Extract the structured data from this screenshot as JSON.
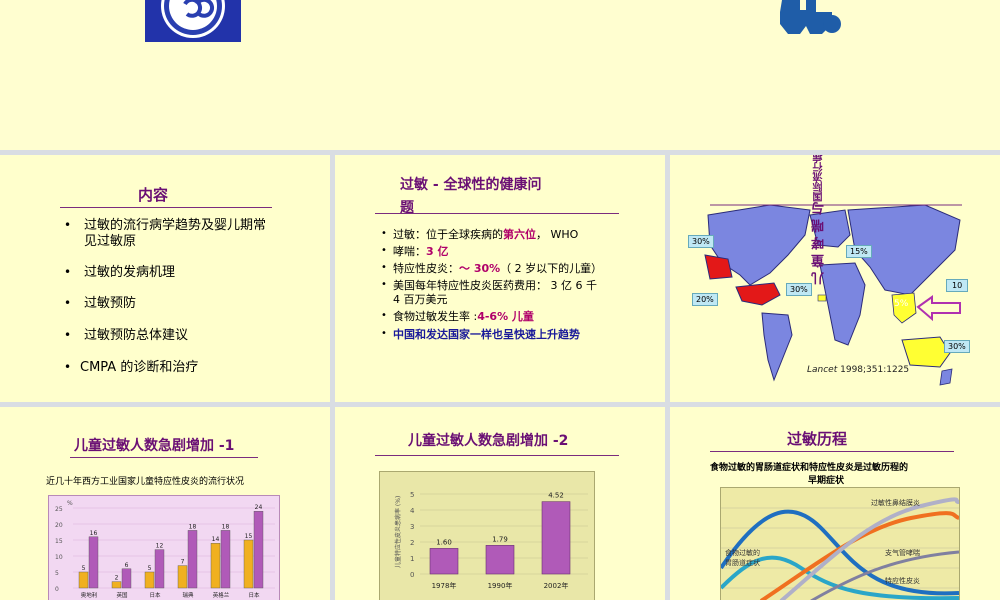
{
  "slide1": {
    "title": "内容",
    "items": [
      "过敏的流行病学趋势及婴儿期常见过敏原",
      "过敏的发病机理",
      "过敏预防",
      "过敏预防总体建议",
      "CMPA 的诊断和治疗"
    ]
  },
  "slide2": {
    "title_a": "过敏 - 全球性的健康问",
    "title_b": "题",
    "b1_pre": "过敏：位于全球疾病的",
    "b1_em": "第六位",
    "b1_post": "， WHO",
    "b2_pre": "哮喘：",
    "b2_em": "3 亿",
    "b3_pre": "特应性皮炎：",
    "b3_em": "～ 30%",
    "b3_post": "（ 2 岁以下的儿童）",
    "b4_a": "美国每年特应性皮炎医药费用： 3 亿 6 千",
    "b4_b": "4 百万美元",
    "b5_pre": "食物过敏发生率 :",
    "b5_em": "4-6% 儿童",
    "b6": "中国和发达国家一样也呈快速上升趋势"
  },
  "slide3": {
    "vtitle_a": "儿 童 哮 喘 与",
    "vtitle_b": "国际流行病学",
    "labels": [
      "30%",
      "15%",
      "20%",
      "30%",
      "10",
      "5%",
      "30%"
    ],
    "citation_a": "Lancet",
    "citation_b": " 1998;351:1225"
  },
  "slide4": {
    "title": "儿童过敏人数急剧增加 -1",
    "subtitle": "近几十年西方工业国家儿童特应性皮炎的流行状况",
    "y_unit": "%",
    "y_ticks": [
      "25",
      "20",
      "15",
      "10",
      "5",
      "0"
    ],
    "countries": [
      "奥地利",
      "英国",
      "日本",
      "瑞典",
      "英格兰",
      "日本"
    ]
  },
  "slide5": {
    "title": "儿童过敏人数急剧增加 -2",
    "y_label": "儿童特应性皮炎患病率 (%)",
    "y_ticks": [
      "5",
      "4",
      "3",
      "2",
      "1",
      "0"
    ]
  },
  "slide6": {
    "title": "过敏历程",
    "subtitle_a": "食物过敏的胃肠道症状和特应性皮炎是过敏历程的",
    "subtitle_b": "早期症状",
    "labels": [
      "过敏性鼻结膜炎",
      "食物过敏的",
      "胃肠道症状",
      "支气管哮喘",
      "特应性皮炎"
    ]
  },
  "chart_data": [
    {
      "type": "bar",
      "categories": [
        "奥地利",
        "英国",
        "日本",
        "瑞典",
        "英格兰",
        "日本"
      ],
      "y_unit": "%",
      "ylim": [
        0,
        25
      ],
      "grid": true,
      "series": [
        {
          "values": [
            5,
            2,
            5,
            7,
            14,
            15
          ],
          "color": "#f0b020",
          "labels": [
            "5",
            "2",
            "5",
            "7",
            "14",
            "15"
          ]
        },
        {
          "values": [
            16,
            6,
            12,
            18,
            18,
            24
          ],
          "color": "#b05ab8",
          "labels": [
            "16",
            "6",
            "12",
            "18",
            "18",
            "24"
          ]
        }
      ]
    },
    {
      "type": "bar",
      "categories": [
        "1978年",
        "1990年",
        "2002年"
      ],
      "values": [
        1.6,
        1.79,
        4.52
      ],
      "value_labels": [
        "1.60",
        "1.79",
        "4.52"
      ],
      "ylim": [
        0,
        5
      ],
      "ylabel": "儿童特应性皮炎患病率 (%)",
      "grid": true,
      "color": "#b05ab8"
    }
  ],
  "colors": {
    "slide_bg": "#ffffcc",
    "title": "#6a0f74",
    "emphasis": "#b0006a",
    "bar_purple": "#b05ab8",
    "bar_gold": "#f0b020"
  }
}
